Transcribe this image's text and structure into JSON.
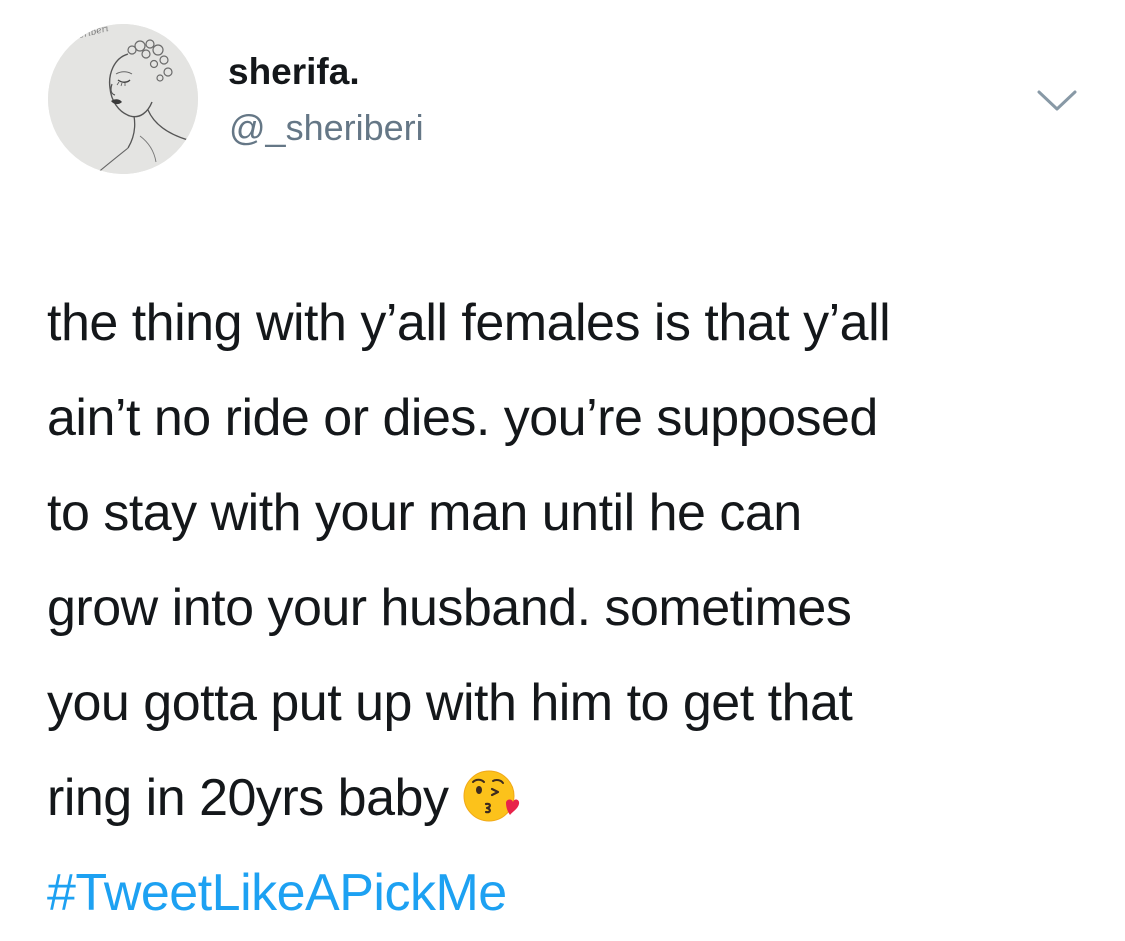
{
  "user": {
    "display_name": "sherifa.",
    "handle": "@_sheriberi",
    "avatar_signature": "@_sheriberi"
  },
  "tweet": {
    "lines": [
      "the thing with y’all females is that y’all",
      "ain’t no ride or dies. you’re supposed",
      "to stay with your man until he can",
      "grow into your husband. sometimes",
      "you gotta put up with him to get that",
      "ring in 20yrs baby"
    ],
    "emoji": "face-throwing-a-kiss",
    "hashtag": "#TweetLikeAPickMe"
  },
  "icons": {
    "menu": "chevron-down-icon"
  },
  "colors": {
    "text": "#14171a",
    "secondary": "#657786",
    "link": "#1da1f2",
    "background": "#ffffff"
  }
}
